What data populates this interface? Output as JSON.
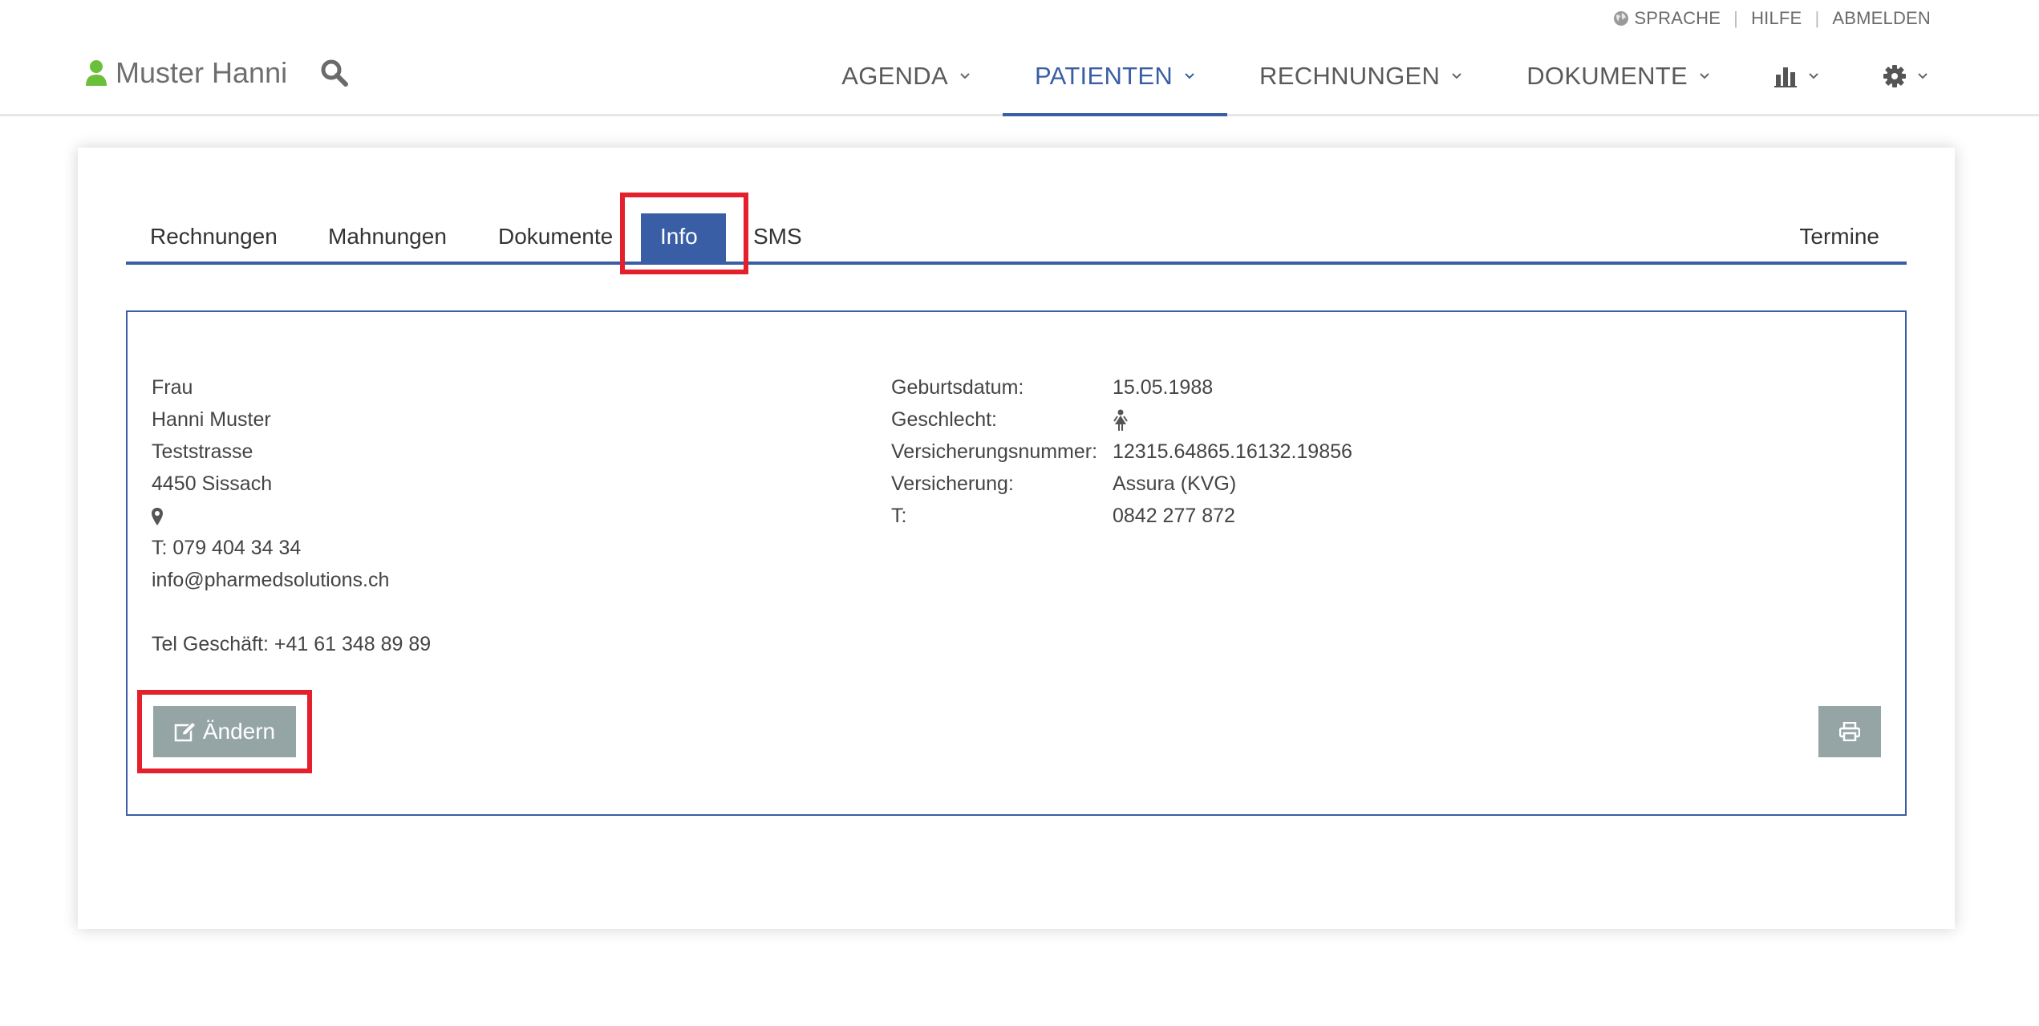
{
  "utility": {
    "language": "SPRACHE",
    "help": "HILFE",
    "logout": "ABMELDEN"
  },
  "header": {
    "user_name": "Muster Hanni",
    "nav": [
      {
        "label": "AGENDA"
      },
      {
        "label": "PATIENTEN"
      },
      {
        "label": "RECHNUNGEN"
      },
      {
        "label": "DOKUMENTE"
      }
    ]
  },
  "tabs": {
    "invoices": "Rechnungen",
    "reminders": "Mahnungen",
    "documents": "Dokumente",
    "info": "Info",
    "sms": "SMS",
    "appointments": "Termine"
  },
  "patient": {
    "salutation": "Frau",
    "name": "Hanni Muster",
    "street": "Teststrasse",
    "city": "4450 Sissach",
    "phone": "T: 079 404 34 34",
    "email": "info@pharmedsolutions.ch",
    "business_phone": "Tel Geschäft: +41 61 348 89 89"
  },
  "details": {
    "birthdate_label": "Geburtsdatum:",
    "birthdate": "15.05.1988",
    "gender_label": "Geschlecht:",
    "insurance_no_label": "Versicherungsnummer:",
    "insurance_no": "12315.64865.16132.19856",
    "insurance_label": "Versicherung:",
    "insurance": "Assura (KVG)",
    "phone_label": "T:",
    "phone": "0842 277 872"
  },
  "actions": {
    "edit_label": "Ändern"
  },
  "colors": {
    "accent": "#3a5ea5",
    "button_grey": "#95a5a6",
    "highlight_red": "#e3202b",
    "user_green": "#6cbf3a"
  }
}
